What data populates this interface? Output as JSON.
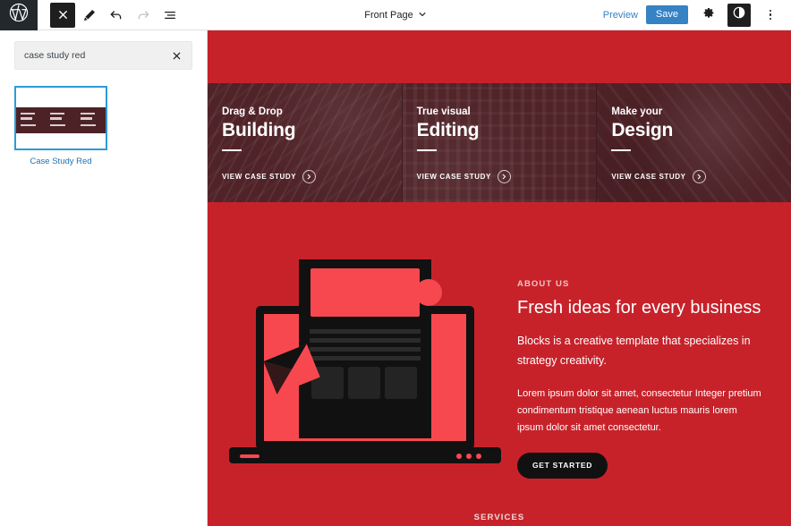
{
  "topbar": {
    "logo_icon": "wordpress-icon",
    "close_icon": "close-x-icon",
    "edit_icon": "pencil-edit-icon",
    "undo_icon": "undo-arrow-icon",
    "redo_icon": "redo-arrow-icon",
    "list_view_icon": "list-view-icon",
    "document_title": "Front Page",
    "document_chevron_icon": "chevron-down-icon",
    "preview_label": "Preview",
    "save_label": "Save",
    "settings_icon": "gear-icon",
    "styles_icon": "contrast-circle-icon",
    "more_icon": "more-vertical-dots-icon",
    "accent_blue": "#3582c4",
    "dark": "#1e1e1e"
  },
  "sidebar": {
    "search": {
      "value": "case study red",
      "placeholder": "Search",
      "clear_icon": "close-x-icon"
    },
    "patterns": [
      {
        "label": "Case Study Red",
        "selected": true,
        "thumb_band_color": "#4d2227",
        "thumb_cells": 3
      }
    ]
  },
  "canvas": {
    "background": "#c7222a",
    "case_study_cards": [
      {
        "kicker": "Drag & Drop",
        "title": "Building",
        "cta": "VIEW CASE STUDY",
        "cta_icon": "circle-arrow-right-icon",
        "overlay_color": "#4f2328"
      },
      {
        "kicker": "True visual",
        "title": "Editing",
        "cta": "VIEW CASE STUDY",
        "cta_icon": "circle-arrow-right-icon",
        "overlay_color": "#4f2328"
      },
      {
        "kicker": "Make your",
        "title": "Design",
        "cta": "VIEW CASE STUDY",
        "cta_icon": "circle-arrow-right-icon",
        "overlay_color": "#4f2328"
      }
    ],
    "about": {
      "illustration_icon": "laptop-design-illustration",
      "kicker": "ABOUT US",
      "title": "Fresh ideas for every business",
      "lead": "Blocks is a creative template that specializes in strategy creativity.",
      "body": "Lorem ipsum dolor sit amet, consectetur Integer pretium condimentum tristique aenean luctus mauris lorem ipsum dolor sit amet consectetur.",
      "cta_label": "GET STARTED"
    },
    "services_heading": "SERVICES"
  }
}
